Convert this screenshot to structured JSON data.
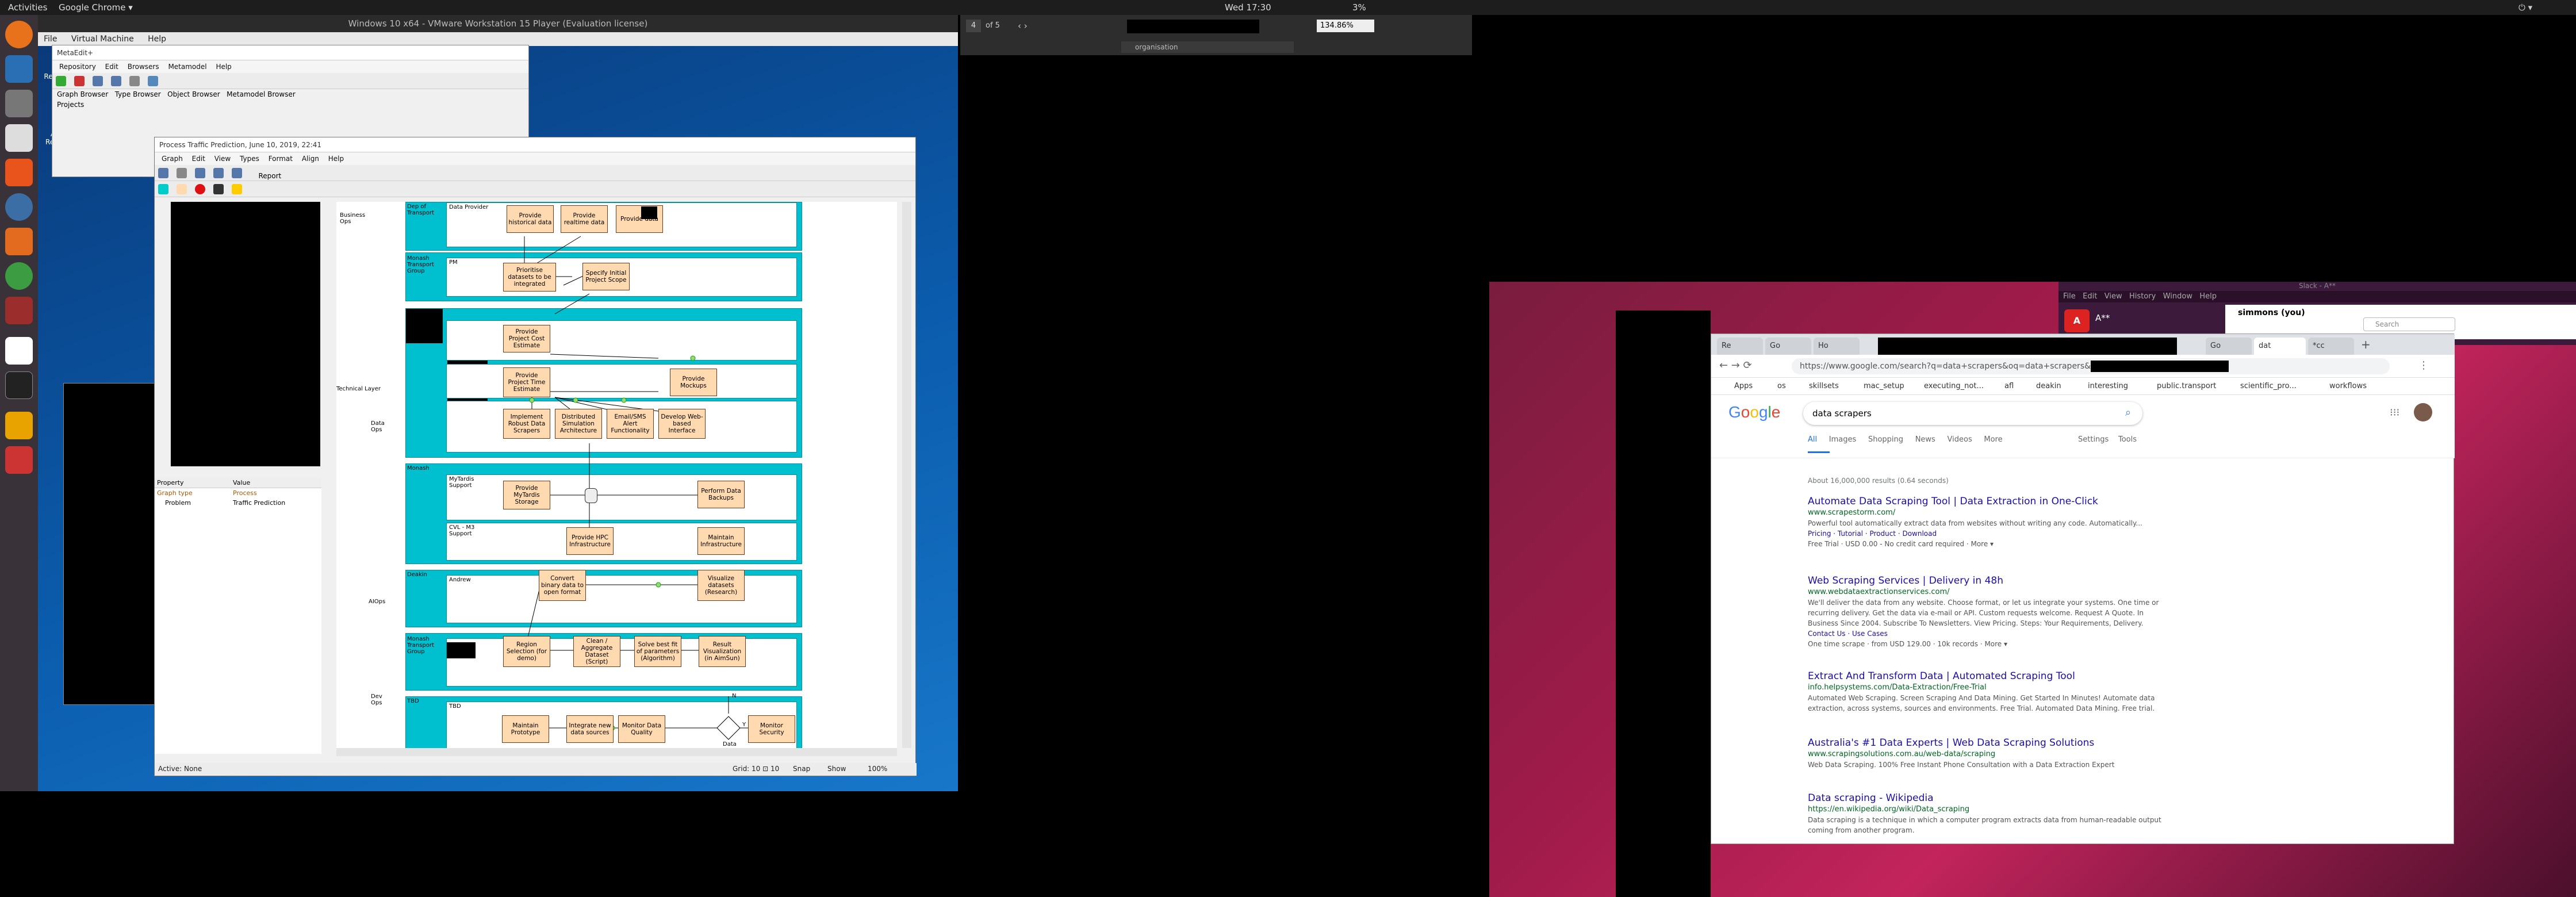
{
  "topbar": {
    "activities": "Activities",
    "app": "Google Chrome ▾",
    "clock": "Wed 17:30",
    "battery": "3%"
  },
  "vmware": {
    "title": "Windows 10 x64 - VMware Workstation 15 Player (Evaluation license)",
    "menu": [
      "File",
      "Virtual Machine",
      "Help"
    ]
  },
  "desktop": {
    "recycle": "Recycle Bin",
    "acrobat": "Acrobat Reader DC"
  },
  "metaedit": {
    "title": "MetaEdit+",
    "menu": [
      "Repository",
      "Edit",
      "Browsers",
      "Metamodel",
      "Help"
    ],
    "tabs": [
      "Graph Browser",
      "Type Browser",
      "Object Browser",
      "Metamodel Browser"
    ],
    "projects": "Projects"
  },
  "ptp": {
    "title": "Process Traffic Prediction, June 10, 2019, 22:41",
    "menu": [
      "Graph",
      "Edit",
      "View",
      "Types",
      "Format",
      "Align",
      "Help"
    ],
    "report": "Report",
    "lanes": {
      "business": "Business Ops",
      "technical": "Technical Layer",
      "data": "Data Ops",
      "aiops": "AIOps",
      "devops": "Dev Ops",
      "monash": "Monash Transport Group",
      "transport": "Dep of Transport",
      "monash_short": "Monash",
      "deakin": "Deakin",
      "mytardis": "MyTardis Support",
      "cvl": "CVL - M3 Support",
      "andrew": "Andrew",
      "tbd": "TBD",
      "tbd2": "TBD",
      "pm": "PM",
      "prov": "Data Provider"
    },
    "tasks": {
      "t1": "Provide historical data",
      "t2": "Provide realtime data",
      "t3": "Provide data",
      "t4": "Prioritise datasets to be integrated",
      "t5": "Specify Initial Project Scope",
      "t6": "Provide Project Cost Estimate",
      "t7": "Provide Project Time Estimate",
      "t8": "Provide Mockups",
      "t9": "Implement Robust Data Scrapers",
      "t10": "Distributed Simulation Architecture",
      "t11": "Email/SMS Alert Functionality",
      "t12": "Develop Web-based Interface",
      "t13": "Provide MyTardis Storage",
      "t14": "Perform Data Backups",
      "t15": "Provide HPC Infrastructure",
      "t16": "Maintain Infrastructure",
      "t17": "Convert binary data to open format",
      "t18": "Visualize datasets (Research)",
      "t19": "Region Selection (for demo)",
      "t20": "Clean / Aggregate Dataset (Script)",
      "t21": "Solve best fit of parameters (Algorithm)",
      "t22": "Result Visualization (in AimSun)",
      "t23": "Maintain Prototype",
      "t24": "Integrate new data sources",
      "t25": "Monitor Data Quality",
      "t26": "Monitor Security",
      "dec": "Data",
      "n": "N",
      "y": "Y"
    },
    "prop": {
      "h1": "Property",
      "h2": "Value",
      "r1k": "Graph type",
      "r1v": "Process",
      "r2k": "Problem",
      "r2v": "Traffic Prediction"
    },
    "status": {
      "active": "Active: None",
      "grid": "Grid: 10 ⊡ 10",
      "snap": "Snap",
      "show": "Show",
      "zoom": "100%"
    }
  },
  "pdf": {
    "page": "4",
    "of": "of 5",
    "zoom": "134.86%",
    "search": "organisation"
  },
  "slack": {
    "title": "Slack - A**",
    "menu": [
      "File",
      "Edit",
      "View",
      "History",
      "Window",
      "Help"
    ],
    "user": "simmons (you)",
    "search": "Search",
    "ws": "A**"
  },
  "chrome": {
    "tabs": [
      "Re",
      "Go",
      "Ho",
      "Go",
      "dat",
      "*cc"
    ],
    "url": "https://www.google.com/search?q=data+scrapers&oq=data+scrapers&aqs=chrome",
    "bookmarks": [
      "Apps",
      "os",
      "skillsets",
      "mac_setup",
      "executing_not...",
      "afl",
      "deakin",
      "interesting",
      "public.transport",
      "scientific_pro...",
      "workflows"
    ],
    "query": "data scrapers",
    "nav": [
      "All",
      "Images",
      "Shopping",
      "News",
      "Videos",
      "More",
      "Settings",
      "Tools"
    ],
    "stats": "About 16,000,000 results (0.64 seconds)",
    "results": [
      {
        "title": "Automate Data Scraping Tool | Data Extraction in One-Click",
        "url": "www.scrapestorm.com/",
        "snip": "Powerful tool automatically extract data from websites without writing any code. Automatically...",
        "links": "Pricing · Tutorial · Product · Download",
        "extra": "Free Trial · USD 0.00 - No credit card required · More ▾"
      },
      {
        "title": "Web Scraping Services | Delivery in 48h",
        "url": "www.webdataextractionservices.com/",
        "snip": "We'll deliver the data from any website. Choose format, or let us integrate your systems. One time or recurring delivery. Get the data via e-mail or API. Custom requests welcome. Request A Quote. In Business Since 2004. Subscribe To Newsletters. View Pricing. Steps: Your Requirements, Delivery.",
        "links": "Contact Us · Use Cases",
        "extra": "One time scrape · from USD 129.00 · 10k records · More ▾"
      },
      {
        "title": "Extract And Transform Data | Automated Scraping Tool",
        "url": "info.helpsystems.com/Data-Extraction/Free-Trial",
        "snip": "Automated Web Scraping. Screen Scraping And Data Mining. Get Started In Minutes! Automate data extraction, across systems, sources and environments. Free Trial. Automated Data Mining. Free trial.",
        "links": "",
        "extra": ""
      },
      {
        "title": "Australia's #1 Data Experts | Web Data Scraping Solutions",
        "url": "www.scrapingsolutions.com.au/web-data/scraping",
        "snip": "Web Data Scraping. 100% Free Instant Phone Consultation with a Data Extraction Expert",
        "links": "",
        "extra": ""
      },
      {
        "title": "Data scraping - Wikipedia",
        "url": "https://en.wikipedia.org/wiki/Data_scraping",
        "snip": "Data scraping is a technique in which a computer program extracts data from human-readable output coming from another program.",
        "links": "",
        "extra": ""
      }
    ]
  }
}
